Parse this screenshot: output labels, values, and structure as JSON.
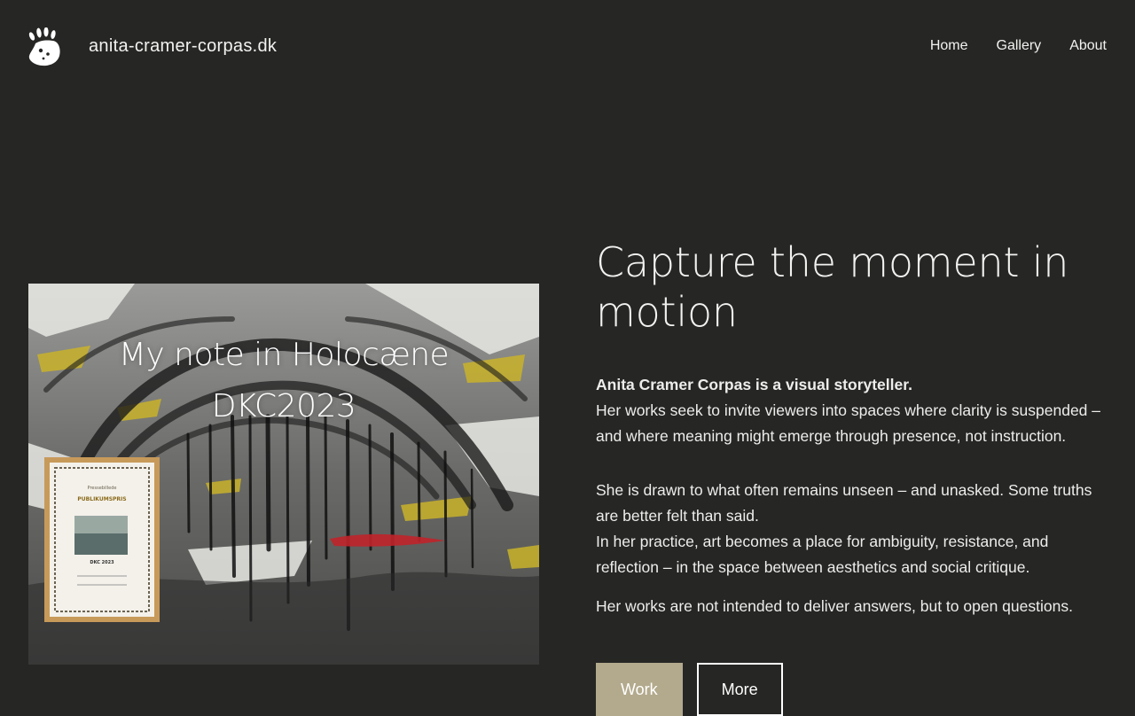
{
  "header": {
    "logo_icon": "hand-print-icon",
    "site_title": "anita-cramer-corpas.dk",
    "nav": [
      {
        "label": "Home"
      },
      {
        "label": "Gallery"
      },
      {
        "label": "About"
      }
    ]
  },
  "artwork": {
    "caption_line1": "My note in Holocæne",
    "caption_line2": "DKC2023",
    "certificate_line1": "Pressebillede",
    "certificate_line2": "PUBLIKUMSPRIS",
    "certificate_line3": "DKC 2023"
  },
  "main": {
    "headline": "Capture the moment in motion",
    "lead_bold": "Anita Cramer Corpas is a visual storyteller.",
    "lead_text": "Her works seek to invite viewers into spaces where clarity is suspended – and where meaning might emerge through presence, not instruction.",
    "para2_line1": "She is drawn to what often remains unseen – and unasked. Some truths are better felt than said.",
    "para2_line2": "In her practice, art becomes a place for ambiguity, resistance, and reflection – in the space between aesthetics and social critique.",
    "para3": "Her works are not intended to deliver answers, but to open questions."
  },
  "buttons": {
    "primary_label": "Work",
    "secondary_label": "More"
  },
  "colors": {
    "background": "#262624",
    "primary_button": "#b3aa8d",
    "text": "#f2f2f0"
  }
}
